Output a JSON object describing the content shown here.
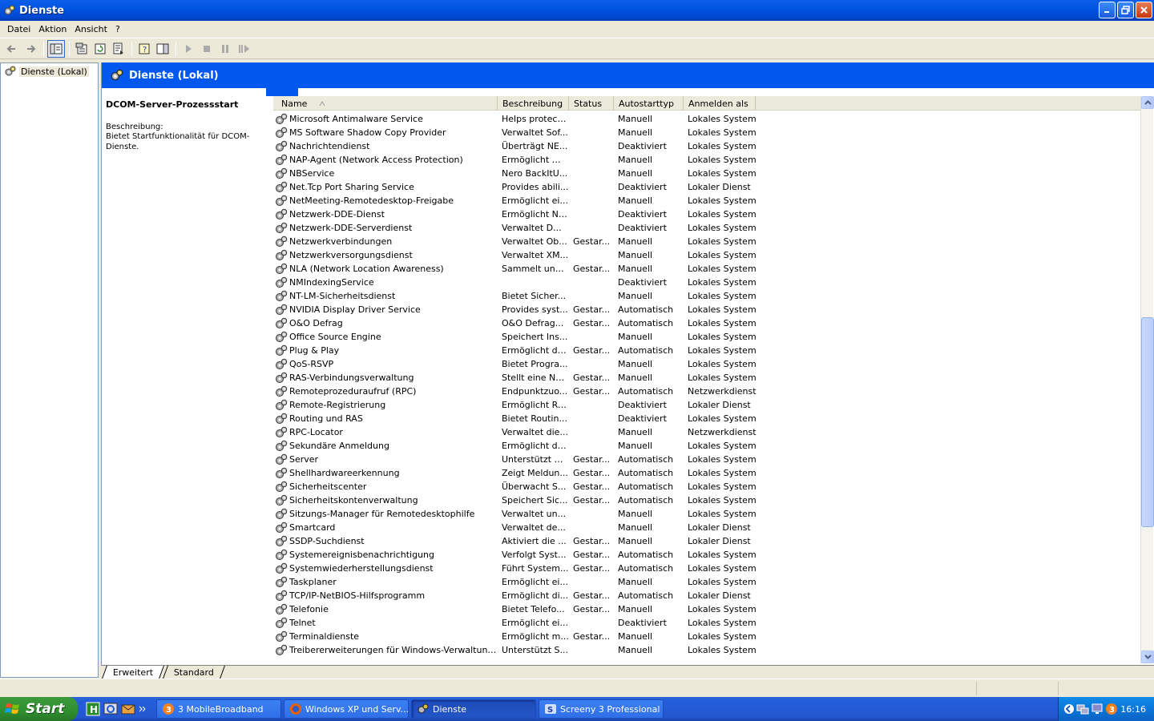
{
  "window": {
    "title": "Dienste"
  },
  "menu": [
    "Datei",
    "Aktion",
    "Ansicht",
    "?"
  ],
  "tree": {
    "root_label": "Dienste (Lokal)"
  },
  "banner": {
    "title": "Dienste (Lokal)"
  },
  "detail": {
    "service_name": "DCOM-Server-Prozessstart",
    "desc_label": "Beschreibung:",
    "desc_text": "Bietet Startfunktionalität für DCOM-Dienste."
  },
  "columns": [
    "Name",
    "Beschreibung",
    "Status",
    "Autostarttyp",
    "Anmelden als"
  ],
  "services": [
    [
      "Microsoft Antimalware Service",
      "Helps protect...",
      "",
      "Manuell",
      "Lokales System"
    ],
    [
      "MS Software Shadow Copy Provider",
      "Verwaltet Sof...",
      "",
      "Manuell",
      "Lokales System"
    ],
    [
      "Nachrichtendienst",
      "Überträgt NE...",
      "",
      "Deaktiviert",
      "Lokales System"
    ],
    [
      "NAP-Agent (Network Access Protection)",
      "Ermöglicht Wi...",
      "",
      "Manuell",
      "Lokales System"
    ],
    [
      "NBService",
      "Nero BackItU...",
      "",
      "Manuell",
      "Lokales System"
    ],
    [
      "Net.Tcp Port Sharing Service",
      "Provides abili...",
      "",
      "Deaktiviert",
      "Lokaler Dienst"
    ],
    [
      "NetMeeting-Remotedesktop-Freigabe",
      "Ermöglicht ei...",
      "",
      "Manuell",
      "Lokales System"
    ],
    [
      "Netzwerk-DDE-Dienst",
      "Ermöglicht Ne...",
      "",
      "Deaktiviert",
      "Lokales System"
    ],
    [
      "Netzwerk-DDE-Serverdienst",
      "Verwaltet D...",
      "",
      "Deaktiviert",
      "Lokales System"
    ],
    [
      "Netzwerkverbindungen",
      "Verwaltet Ob...",
      "Gestar...",
      "Manuell",
      "Lokales System"
    ],
    [
      "Netzwerkversorgungsdienst",
      "Verwaltet XM...",
      "",
      "Manuell",
      "Lokales System"
    ],
    [
      "NLA (Network Location Awareness)",
      "Sammelt und ...",
      "Gestar...",
      "Manuell",
      "Lokales System"
    ],
    [
      "NMIndexingService",
      "",
      "",
      "Deaktiviert",
      "Lokales System"
    ],
    [
      "NT-LM-Sicherheitsdienst",
      "Bietet Sicher...",
      "",
      "Manuell",
      "Lokales System"
    ],
    [
      "NVIDIA Display Driver Service",
      "Provides syst...",
      "Gestar...",
      "Automatisch",
      "Lokales System"
    ],
    [
      "O&O Defrag",
      "O&O Defrag...",
      "Gestar...",
      "Automatisch",
      "Lokales System"
    ],
    [
      "Office Source Engine",
      "Speichert Ins...",
      "",
      "Manuell",
      "Lokales System"
    ],
    [
      "Plug & Play",
      "Ermöglicht de...",
      "Gestar...",
      "Automatisch",
      "Lokales System"
    ],
    [
      "QoS-RSVP",
      "Bietet Progra...",
      "",
      "Manuell",
      "Lokales System"
    ],
    [
      "RAS-Verbindungsverwaltung",
      "Stellt eine Ne...",
      "Gestar...",
      "Manuell",
      "Lokales System"
    ],
    [
      "Remoteprozeduraufruf (RPC)",
      "Endpunktzuo...",
      "Gestar...",
      "Automatisch",
      "Netzwerkdienst"
    ],
    [
      "Remote-Registrierung",
      "Ermöglicht Re...",
      "",
      "Deaktiviert",
      "Lokaler Dienst"
    ],
    [
      "Routing und RAS",
      "Bietet Routin...",
      "",
      "Deaktiviert",
      "Lokales System"
    ],
    [
      "RPC-Locator",
      "Verwaltet die...",
      "",
      "Manuell",
      "Netzwerkdienst"
    ],
    [
      "Sekundäre Anmeldung",
      "Ermöglicht da...",
      "",
      "Manuell",
      "Lokales System"
    ],
    [
      "Server",
      "Unterstützt D...",
      "Gestar...",
      "Automatisch",
      "Lokales System"
    ],
    [
      "Shellhardwareerkennung",
      "Zeigt Meldun...",
      "Gestar...",
      "Automatisch",
      "Lokales System"
    ],
    [
      "Sicherheitscenter",
      "Überwacht S...",
      "Gestar...",
      "Automatisch",
      "Lokales System"
    ],
    [
      "Sicherheitskontenverwaltung",
      "Speichert Sic...",
      "Gestar...",
      "Automatisch",
      "Lokales System"
    ],
    [
      "Sitzungs-Manager für Remotedesktophilfe",
      "Verwaltet un...",
      "",
      "Manuell",
      "Lokales System"
    ],
    [
      "Smartcard",
      "Verwaltet de...",
      "",
      "Manuell",
      "Lokaler Dienst"
    ],
    [
      "SSDP-Suchdienst",
      "Aktiviert die ...",
      "Gestar...",
      "Manuell",
      "Lokaler Dienst"
    ],
    [
      "Systemereignisbenachrichtigung",
      "Verfolgt Syst...",
      "Gestar...",
      "Automatisch",
      "Lokales System"
    ],
    [
      "Systemwiederherstellungsdienst",
      "Führt System...",
      "Gestar...",
      "Automatisch",
      "Lokales System"
    ],
    [
      "Taskplaner",
      "Ermöglicht ei...",
      "",
      "Manuell",
      "Lokales System"
    ],
    [
      "TCP/IP-NetBIOS-Hilfsprogramm",
      "Ermöglicht di...",
      "Gestar...",
      "Automatisch",
      "Lokaler Dienst"
    ],
    [
      "Telefonie",
      "Bietet Telefo...",
      "Gestar...",
      "Manuell",
      "Lokales System"
    ],
    [
      "Telnet",
      "Ermöglicht ei...",
      "",
      "Deaktiviert",
      "Lokales System"
    ],
    [
      "Terminaldienste",
      "Ermöglicht m...",
      "Gestar...",
      "Manuell",
      "Lokales System"
    ],
    [
      "Treibererweiterungen für Windows-Verwaltungsins...",
      "Unterstützt S...",
      "",
      "Manuell",
      "Lokales System"
    ]
  ],
  "tabs": [
    "Erweitert",
    "Standard"
  ],
  "taskbar": {
    "start_label": "Start",
    "buttons": [
      "3 MobileBroadband",
      "Windows XP und Serv...",
      "Dienste",
      "Screeny 3 Professional"
    ],
    "active_index": 2,
    "clock": "16:16"
  },
  "colors": {
    "titlebar": "#0054e3",
    "banner": "#0058ee",
    "taskbar": "#245edb",
    "start": "#2f8f2f"
  }
}
